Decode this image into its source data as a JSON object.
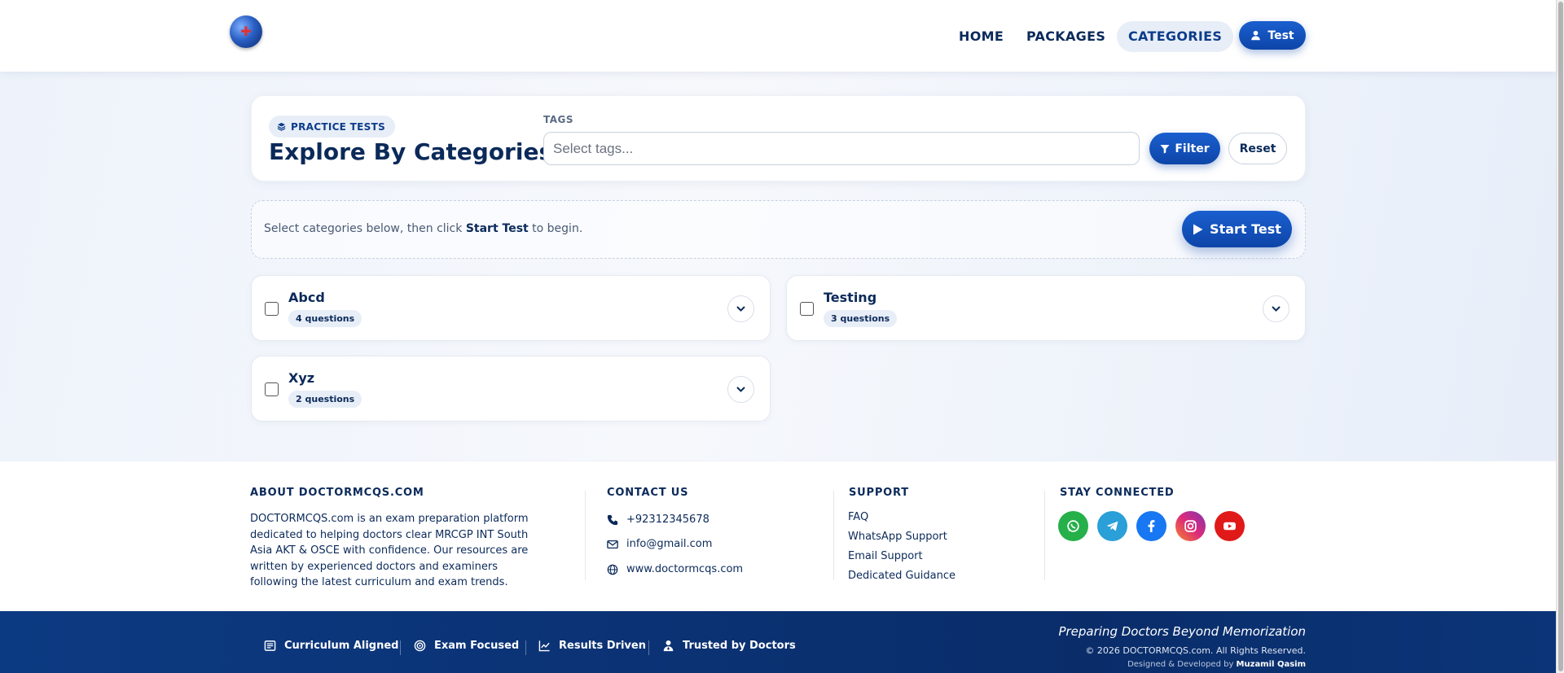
{
  "nav": {
    "links": [
      "HOME",
      "PACKAGES",
      "CATEGORIES"
    ],
    "active": "CATEGORIES",
    "user_label": "Test"
  },
  "hero": {
    "pill": "PRACTICE TESTS",
    "title": "Explore By Categories",
    "tags_label": "TAGS",
    "tags_placeholder": "Select tags...",
    "filter_label": "Filter",
    "reset_label": "Reset"
  },
  "instructions": {
    "before": "Select categories below, then click ",
    "emphasis": "Start Test",
    "after": " to begin.",
    "start_label": "Start Test"
  },
  "categories": [
    {
      "name": "Abcd",
      "count": "4 questions"
    },
    {
      "name": "Testing",
      "count": "3 questions"
    },
    {
      "name": "Xyz",
      "count": "2 questions"
    }
  ],
  "footer": {
    "about_heading": "ABOUT DOCTORMCQS.COM",
    "about_text": "DOCTORMCQS.com is an exam preparation platform dedicated to helping doctors clear MRCGP INT South Asia AKT & OSCE with confidence. Our resources are written by experienced doctors and examiners following the latest curriculum and exam trends.",
    "contact_heading": "CONTACT US",
    "phone": "+92312345678",
    "email": "info@gmail.com",
    "website": "www.doctormcqs.com",
    "support_heading": "SUPPORT",
    "support_links": [
      "FAQ",
      "WhatsApp Support",
      "Email Support",
      "Dedicated Guidance"
    ],
    "social_heading": "STAY CONNECTED",
    "social": [
      {
        "icon": "whatsapp-icon",
        "color": "#25b04a"
      },
      {
        "icon": "telegram-icon",
        "color": "#2a9fd8"
      },
      {
        "icon": "facebook-icon",
        "color": "#1877f2"
      },
      {
        "icon": "instagram-icon",
        "color": "#d6336c"
      },
      {
        "icon": "youtube-icon",
        "color": "#e01919"
      }
    ]
  },
  "bottom_bar": {
    "features": [
      "Curriculum Aligned",
      "Exam Focused",
      "Results Driven",
      "Trusted by Doctors"
    ],
    "tagline": "Preparing Doctors Beyond Memorization",
    "copyright": "© 2026 DOCTORMCQS.com. All Rights Reserved.",
    "credit_prefix": "Designed & Developed by ",
    "credit_name": "Muzamil Qasim"
  },
  "colors": {
    "primary": "#0d45a8",
    "navy": "#0b2a5a",
    "footer_bar": "#0a2d6a"
  }
}
